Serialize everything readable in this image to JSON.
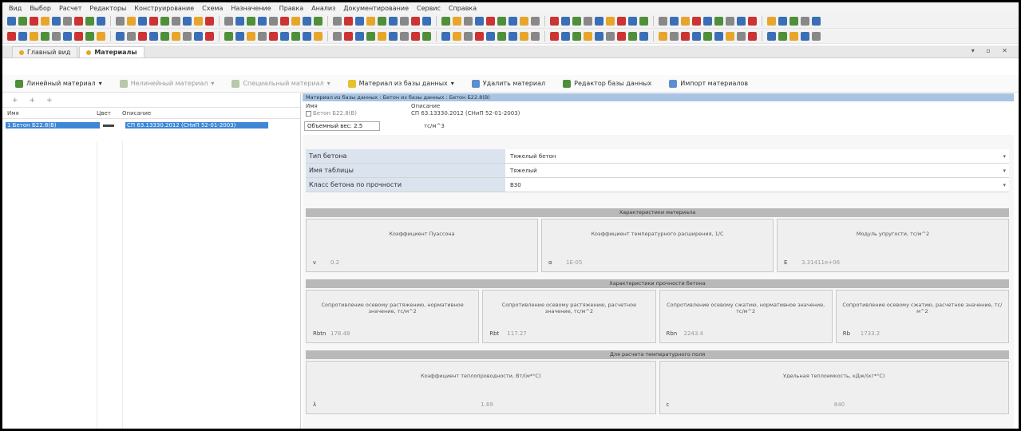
{
  "menu": [
    "Вид",
    "Выбор",
    "Расчет",
    "Редакторы",
    "Конструирование",
    "Схема",
    "Назначение",
    "Правка",
    "Анализ",
    "Документирование",
    "Сервис",
    "Справка"
  ],
  "toolbar_colors": {
    "row1": [
      "#3a6fb5",
      "#4f8f3a",
      "#c33",
      "#e8a52c",
      "#3a6fb5",
      "#888",
      "#c33",
      "#4f8f3a",
      "#3a6fb5",
      "#888",
      "#e8a52c",
      "#3a6fb5",
      "#c33",
      "#4f8f3a",
      "#888",
      "#3a6fb5",
      "#e8a52c",
      "#c33",
      "#888",
      "#3a6fb5",
      "#4f8f3a",
      "#3a6fb5",
      "#888",
      "#c33",
      "#e8a52c",
      "#3a6fb5",
      "#4f8f3a",
      "#888",
      "#c33",
      "#3a6fb5",
      "#e8a52c",
      "#4f8f3a",
      "#3a6fb5",
      "#888",
      "#c33",
      "#3a6fb5",
      "#4f8f3a",
      "#e8a52c",
      "#888",
      "#3a6fb5",
      "#c33",
      "#4f8f3a",
      "#3a6fb5",
      "#e8a52c",
      "#888",
      "#c33",
      "#3a6fb5",
      "#4f8f3a",
      "#888",
      "#3a6fb5",
      "#e8a52c",
      "#c33",
      "#3a6fb5",
      "#4f8f3a",
      "#888",
      "#3a6fb5",
      "#e8a52c",
      "#c33",
      "#3a6fb5",
      "#4f8f3a",
      "#888",
      "#3a6fb5",
      "#c33",
      "#e8a52c",
      "#3a6fb5",
      "#4f8f3a",
      "#888",
      "#3a6fb5"
    ],
    "row2": [
      "#c33",
      "#3a6fb5",
      "#e8a52c",
      "#4f8f3a",
      "#888",
      "#3a6fb5",
      "#c33",
      "#4f8f3a",
      "#e8a52c",
      "#3a6fb5",
      "#888",
      "#c33",
      "#3a6fb5",
      "#4f8f3a",
      "#e8a52c",
      "#888",
      "#3a6fb5",
      "#c33",
      "#4f8f3a",
      "#3a6fb5",
      "#e8a52c",
      "#888",
      "#c33",
      "#3a6fb5",
      "#4f8f3a",
      "#3a6fb5",
      "#e8a52c",
      "#888",
      "#c33",
      "#3a6fb5",
      "#4f8f3a",
      "#e8a52c",
      "#3a6fb5",
      "#888",
      "#c33",
      "#4f8f3a",
      "#3a6fb5",
      "#e8a52c",
      "#888",
      "#c33",
      "#3a6fb5",
      "#4f8f3a",
      "#3a6fb5",
      "#e8a52c",
      "#888",
      "#c33",
      "#3a6fb5",
      "#4f8f3a",
      "#e8a52c",
      "#3a6fb5",
      "#888",
      "#c33",
      "#4f8f3a",
      "#3a6fb5",
      "#e8a52c",
      "#888",
      "#c33",
      "#3a6fb5",
      "#4f8f3a",
      "#3a6fb5",
      "#e8a52c",
      "#888",
      "#c33",
      "#3a6fb5",
      "#4f8f3a",
      "#e8a52c",
      "#3a6fb5",
      "#888"
    ]
  },
  "doc_tabs": {
    "main": "Главный вид",
    "materials": "Материалы"
  },
  "material_toolbar": {
    "linear": "Линейный материал",
    "nonlinear": "Нелинейный материал",
    "special": "Специальный материал",
    "from_db": "Материал из базы данных",
    "delete": "Удалить материал",
    "db_editor": "Редактор базы данных",
    "import": "Импорт материалов"
  },
  "list": {
    "headers": {
      "name": "Имя",
      "color": "Цвет",
      "desc": "Описание"
    },
    "rows": [
      {
        "name": "1 Бетон Б22.8(В)",
        "desc": "СП 63.13330.2012 (СНиП 52-01-2003)"
      }
    ]
  },
  "detail": {
    "title": "Материал из базы данных : Бетон из базы данных : Бетон Б22.8(В)",
    "name_label": "Имя",
    "name_value": "Бетон Б22.8(В)",
    "desc_label": "Описание",
    "desc_value": "СП 63.13330.2012 (СНиП 52-01-2003)",
    "weight_label": "Объемный вес:",
    "weight_value": "2.5",
    "weight_unit": "тс/м^3"
  },
  "props": [
    {
      "key": "Тип бетона",
      "value": "Тяжелый бетон"
    },
    {
      "key": "Имя таблицы",
      "value": "Тяжелый"
    },
    {
      "key": "Класс бетона по прочности",
      "value": "B30"
    }
  ],
  "sections": {
    "material": "Характеристики материала",
    "strength": "Характеристики прочности бетона",
    "thermal": "Для расчета температурного поля"
  },
  "material_cards": [
    {
      "title": "Коэффициент Пуассона",
      "sym": "ν",
      "value": "0.2"
    },
    {
      "title": "Коэффициент температурного расширения, 1/С",
      "sym": "α",
      "value": "1Е-05"
    },
    {
      "title": "Модуль упругости, тс/м^2",
      "sym": "E",
      "value": "3.31411е+06"
    }
  ],
  "strength_cards": [
    {
      "title": "Сопротивление осевому растяжению, нормативное значение, тс/м^2",
      "sym": "Rbtn",
      "value": "178.48"
    },
    {
      "title": "Сопротивление осевому растяжению, расчетное значение, тс/м^2",
      "sym": "Rbt",
      "value": "117.27"
    },
    {
      "title": "Сопротивление осевому сжатию, нормативное значение, тс/м^2",
      "sym": "Rbn",
      "value": "2243.4"
    },
    {
      "title": "Сопротивление осевому сжатию, расчетное значение, тс/м^2",
      "sym": "Rb",
      "value": "1733.2"
    }
  ],
  "thermal_cards": [
    {
      "title": "Коэффициент теплопроводности, Вт/(м*°С)",
      "sym": "λ",
      "value": "1.69"
    },
    {
      "title": "Удельная теплоемкость, кДж/(кг*°С)",
      "sym": "c",
      "value": "840"
    }
  ]
}
